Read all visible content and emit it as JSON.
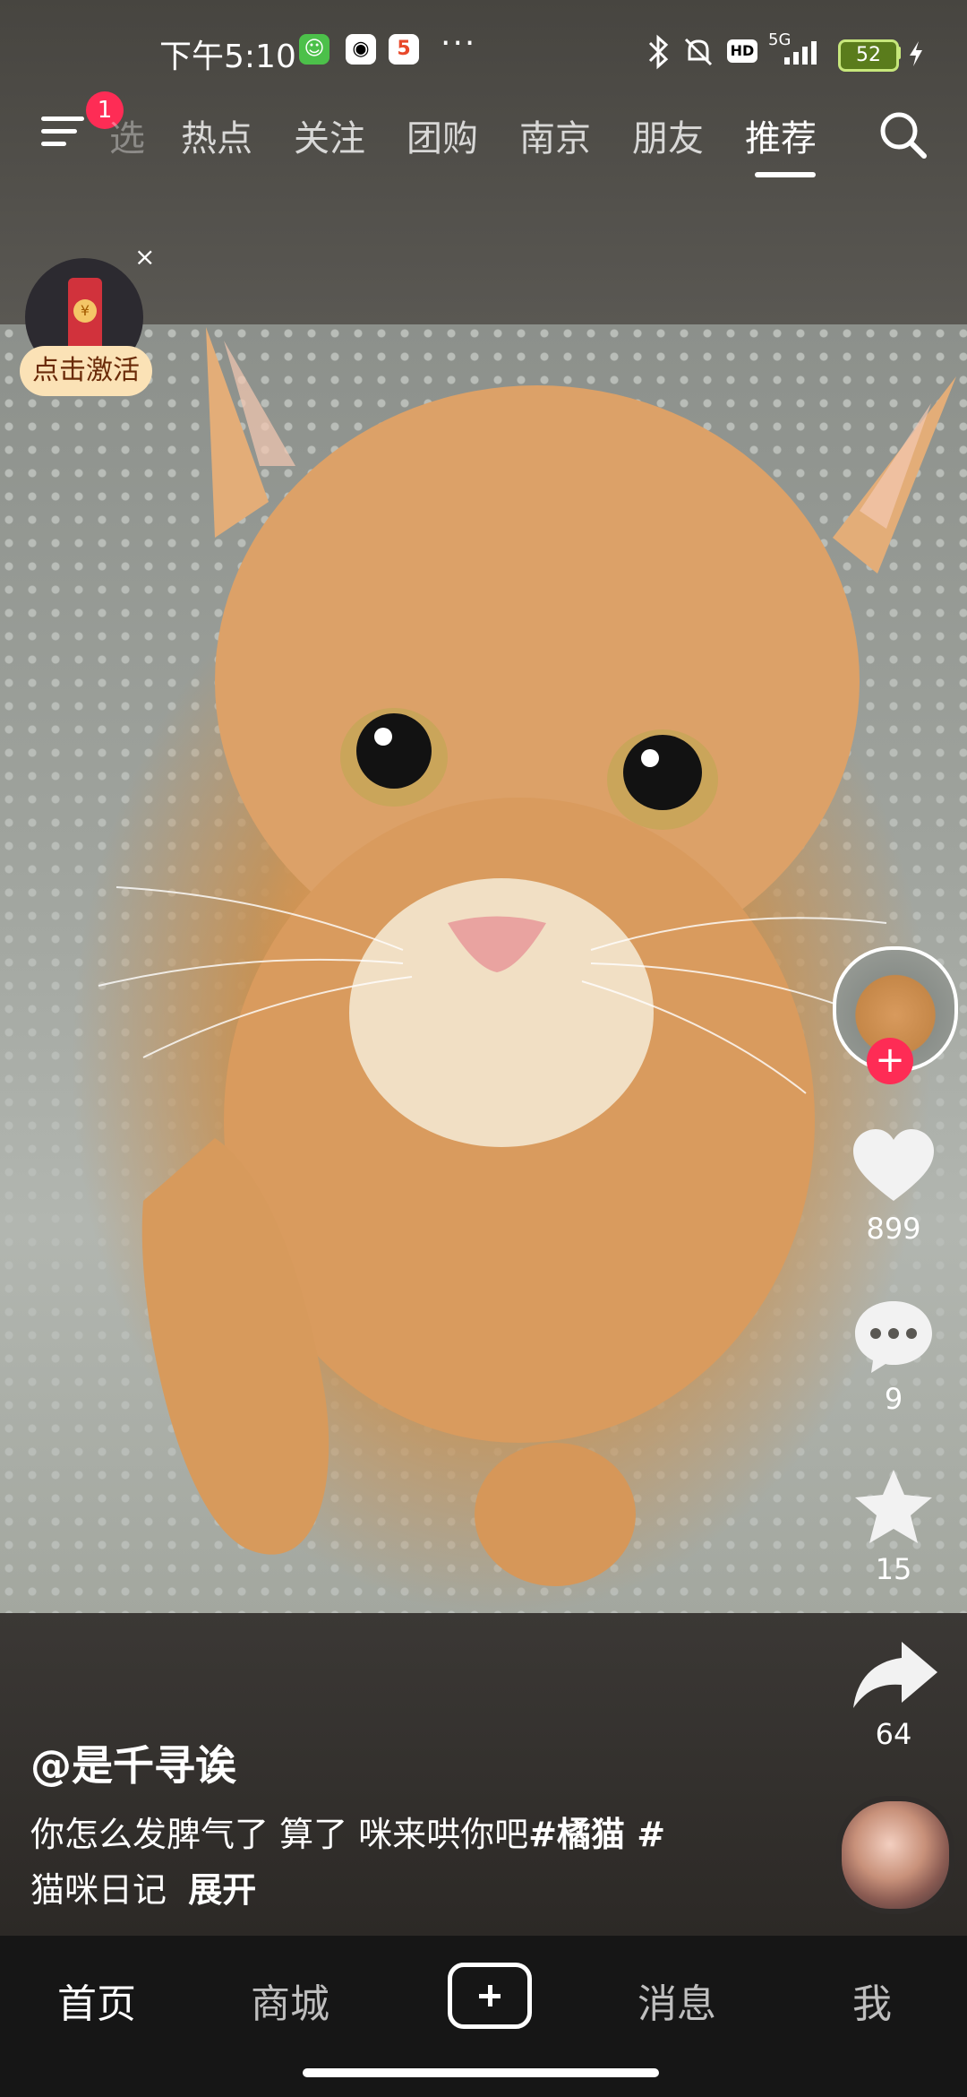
{
  "status_bar": {
    "time": "下午5:10",
    "more": "···",
    "network": "5G",
    "hd": "HD",
    "battery": "52"
  },
  "top_nav": {
    "menu_badge": "1",
    "tabs": [
      {
        "label": "选"
      },
      {
        "label": "热点"
      },
      {
        "label": "关注"
      },
      {
        "label": "团购"
      },
      {
        "label": "南京"
      },
      {
        "label": "朋友"
      },
      {
        "label": "推荐",
        "active": true
      }
    ]
  },
  "promo": {
    "close": "×",
    "label": "点击激活",
    "coin": "¥"
  },
  "right_rail": {
    "follow_plus": "+",
    "likes": "899",
    "comments": "9",
    "favorites": "15",
    "shares": "64"
  },
  "post": {
    "author": "@是千寻诶",
    "caption_line1": "你怎么发脾气了  算了  咪来哄你吧",
    "tag1": "#橘猫",
    "tag2_prefix": " #",
    "caption_line2": "猫咪日记",
    "expand": "展开"
  },
  "bottom_nav": {
    "home": "首页",
    "mall": "商城",
    "messages": "消息",
    "me": "我"
  },
  "colors": {
    "accent": "#fe2c55",
    "battery": "#c7e77b"
  }
}
